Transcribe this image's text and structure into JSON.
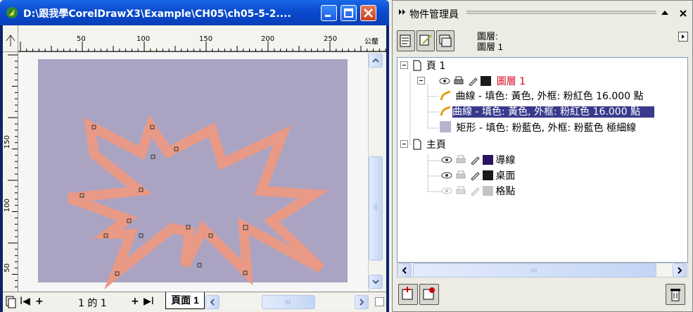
{
  "window": {
    "title": "D:\\跟我學CorelDrawX3\\Example\\CH05\\ch05-5-2...."
  },
  "rulers": {
    "unit": "公釐",
    "h_ticks": [
      "50",
      "100",
      "150",
      "200",
      "250"
    ],
    "v_ticks": [
      "150",
      "100",
      "50"
    ]
  },
  "page_nav": {
    "first": "I◀",
    "add_before": "+",
    "page_indicator": "1 的 1",
    "add_after": "+",
    "last": "▶I",
    "tab_label": "頁面 1"
  },
  "docker": {
    "title": "物件管理員",
    "layer_header_line1": "圖層:",
    "layer_header_line2": "圖層 1",
    "tree": {
      "page1": "頁 1",
      "layer1": "圖層 1",
      "curve1": "曲線 - 填色: 黃色, 外框: 粉紅色  16.000 點",
      "curve2": "曲線 - 填色: 黃色, 外框: 粉紅色  16.000 點",
      "rect": "矩形 - 填色: 粉藍色, 外框: 粉藍色  極細線",
      "master": "主頁",
      "guides": "導線",
      "desktop": "桌面",
      "grid": "格點"
    }
  },
  "colors": {
    "title_bar": "#0b4ecf",
    "page_fill": "#aba3c2",
    "star_fill": "#e89a86",
    "layer1_color": "#d5001c",
    "selection": "#3a3a8c",
    "guides_swatch": "#2a1560",
    "desktop_swatch": "#1a1a1a",
    "grid_swatch": "#c4c4c4",
    "rect_swatch": "#b9b2cf"
  }
}
